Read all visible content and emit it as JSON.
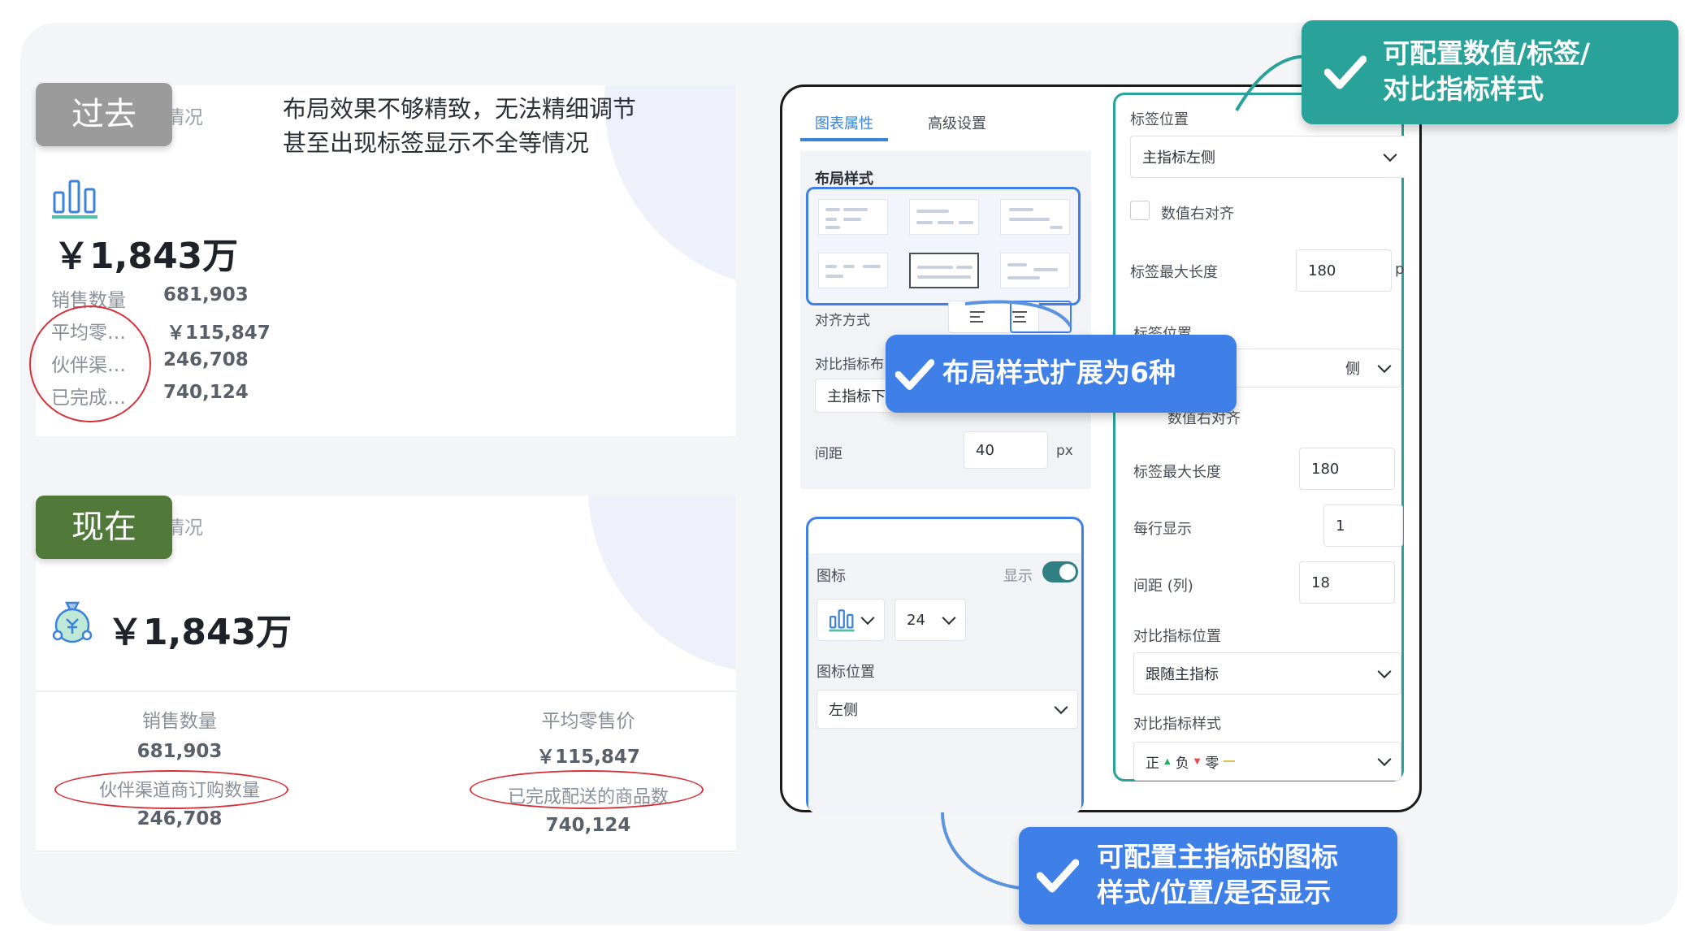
{
  "before": {
    "badge": "过去",
    "title_fragment": "情况",
    "issue_line1": "布局效果不够精致，无法精细调节",
    "issue_line2": "甚至出现标签显示不全等情况",
    "main_value": "￥1,843万",
    "metrics": [
      {
        "label": "销售数量",
        "value": "681,903"
      },
      {
        "label": "平均零…",
        "value": "￥115,847"
      },
      {
        "label": "伙伴渠…",
        "value": "246,708"
      },
      {
        "label": "已完成…",
        "value": "740,124"
      }
    ]
  },
  "after": {
    "badge": "现在",
    "title_fragment": "情况",
    "main_value": "￥1,843万",
    "sub_metrics": [
      {
        "label": "销售数量",
        "value": "681,903",
        "label2": "伙伴渠道商订购数量",
        "value2": "246,708"
      },
      {
        "label": "平均零售价",
        "value": "￥115,847",
        "label2": "已完成配送的商品数",
        "value2": "740,124"
      }
    ]
  },
  "settings": {
    "tabs": [
      "图表属性",
      "高级设置"
    ],
    "layout_style_label": "布局样式",
    "align_label": "对齐方式",
    "compare_label": "对比指标布",
    "compare_select": "主指标下",
    "spacing_label": "间距",
    "spacing_value": "40",
    "spacing_unit": "px",
    "icon_section": {
      "label": "图标",
      "show_label": "显示",
      "size_value": "24",
      "position_label": "图标位置",
      "position_value": "左侧"
    }
  },
  "label_panel": {
    "label_position": "标签位置",
    "label_position_value": "主指标左侧",
    "right_align": "数值右对齐",
    "max_len_label": "标签最大长度",
    "max_len_value": "180",
    "max_len_unit": "p",
    "label_position2": "标签位置",
    "label_position2_value_fragment": "侧",
    "right_align2": "数值右对齐",
    "max_len_label2": "标签最大长度",
    "max_len_value2": "180",
    "per_row_label": "每行显示",
    "per_row_value": "1",
    "col_gap_label": "间距 (列)",
    "col_gap_value": "18",
    "compare_pos_label": "对比指标位置",
    "compare_pos_value": "跟随主指标",
    "compare_style_label": "对比指标样式",
    "compare_style_value": {
      "pos": "正",
      "neg": "负",
      "zero": "零"
    }
  },
  "callouts": {
    "top": [
      "可配置数值/标签/",
      "对比指标样式"
    ],
    "middle": "布局样式扩展为6种",
    "bottom": [
      "可配置主指标的图标",
      "样式/位置/是否显示"
    ]
  },
  "colors": {
    "accent_blue": "#3f80e8",
    "accent_teal": "#29a39a",
    "badge_old": "#9b9b9b",
    "badge_new": "#50793a",
    "annotation_red": "#d6313a",
    "compare_pos": "#2fa866",
    "compare_neg": "#e24c4c",
    "compare_zero": "#d7c24a"
  },
  "icons": [
    "bar-chart-icon",
    "money-bag-icon",
    "check-icon",
    "chevron-down-icon",
    "align-left-icon",
    "align-center-icon"
  ]
}
